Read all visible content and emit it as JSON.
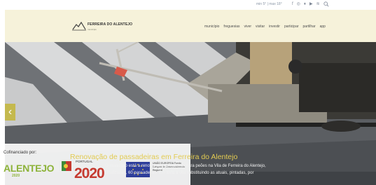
{
  "weather": {
    "text": "min 5° | max 18°"
  },
  "social_icons": [
    "facebook-icon",
    "instagram-icon",
    "twitter-icon",
    "youtube-icon",
    "rss-icon",
    "search-icon"
  ],
  "logo": {
    "name": "FERREIRA DO ALENTEJO",
    "subtitle": "município"
  },
  "nav": [
    {
      "label": "município"
    },
    {
      "label": "freguesias"
    },
    {
      "label": "viver"
    },
    {
      "label": "visitar"
    },
    {
      "label": "investir"
    },
    {
      "label": "participar"
    },
    {
      "label": "partilhar"
    },
    {
      "label": "app"
    }
  ],
  "slider": {
    "title": "Renovação de passadeiras em Ferreira do Alentejo",
    "text": "O município está a renovar as passadeiras para peões na Vila de Ferreira do Alentejo, sinalizadas, 60 passadeiras. Em toda a vila substituindo as atuais, pintadas, por",
    "prev_icon": "chevron-left-icon"
  },
  "funding": {
    "label": "Cofinanciado por:",
    "alentejo": "ALENTEJO",
    "alentejo_year": "2020",
    "portugal_label": "PORTUGAL",
    "portugal_year": "2020",
    "eu_text": "UNIÃO EUROPEIA Fundo Europeu de Desenvolvimento Regional"
  },
  "colors": {
    "header_bg": "#f6f2da",
    "accent": "#c4b94e",
    "title": "#e2cb52",
    "alentejo_green": "#8db33a",
    "portugal_red": "#c53a30",
    "eu_blue": "#2e3e9a"
  }
}
